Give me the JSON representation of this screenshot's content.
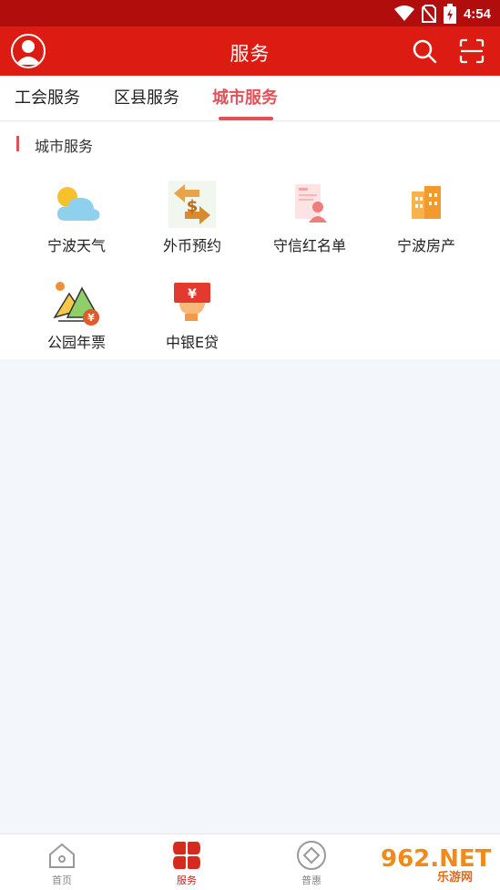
{
  "status_bar": {
    "time": "4:54"
  },
  "app_bar": {
    "title": "服务"
  },
  "tabs": [
    {
      "label": "工会服务"
    },
    {
      "label": "区县服务"
    },
    {
      "label": "城市服务"
    }
  ],
  "section": {
    "title": "城市服务",
    "items": [
      {
        "label": "宁波天气",
        "icon": "weather-icon"
      },
      {
        "label": "外币预约",
        "icon": "currency-exchange-icon"
      },
      {
        "label": "守信红名单",
        "icon": "credit-list-icon"
      },
      {
        "label": "宁波房产",
        "icon": "buildings-icon"
      },
      {
        "label": "公园年票",
        "icon": "park-ticket-icon"
      },
      {
        "label": "中银E贷",
        "icon": "loan-icon"
      }
    ]
  },
  "bottom_nav": [
    {
      "label": "首页"
    },
    {
      "label": "服务"
    },
    {
      "label": "普惠"
    }
  ],
  "watermark": {
    "text_main": "962.NET",
    "text_sub": "乐游网"
  },
  "colors": {
    "header": "#dc1c13",
    "statusbar": "#b10d0d",
    "accent": "#e0525a"
  }
}
